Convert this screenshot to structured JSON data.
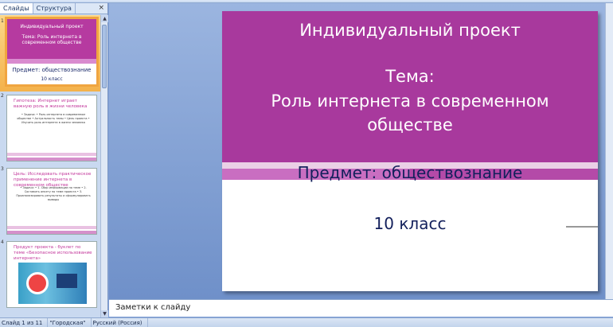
{
  "panel": {
    "tabs": [
      {
        "label": "Слайды"
      },
      {
        "label": "Структура"
      }
    ],
    "close": "×"
  },
  "thumbnails": [
    {
      "num": "1",
      "title": "Индивидуальный проект",
      "topic": "Тема: Роль интернета в современном обществе",
      "subject": "Предмет: обществознание",
      "class": "10 класс"
    },
    {
      "num": "2",
      "heading": "Гипотеза: Интернет играет важную роль в жизни человека",
      "body": "• Задачи: • Роль интернета в современном обществе • Актуальность темы • Цель проекта • Изучить роль интернета в жизни человека"
    },
    {
      "num": "3",
      "heading": "Цель: Исследовать практическое применение интернета в современном обществе",
      "body": "• Задачи: • 1. Сбор информации по теме • 2. Составить анкету по теме проекта • 3. Проанализировать результаты и сформулировать выводы"
    },
    {
      "num": "4",
      "heading": "Продукт проекта - буклет по теме «Безопасное использование интернета»"
    }
  ],
  "slide": {
    "title": "Индивидуальный проект",
    "topic_label": "Тема:",
    "topic_line1": "Роль интернета в современном",
    "topic_line2": "обществе",
    "subject": "Предмет: обществознание",
    "class": "10 класс"
  },
  "notes": {
    "placeholder": "Заметки к слайду"
  },
  "status": {
    "slide": "Слайд 1 из 11",
    "theme": "\"Городская\"",
    "language": "Русский (Россия)"
  }
}
